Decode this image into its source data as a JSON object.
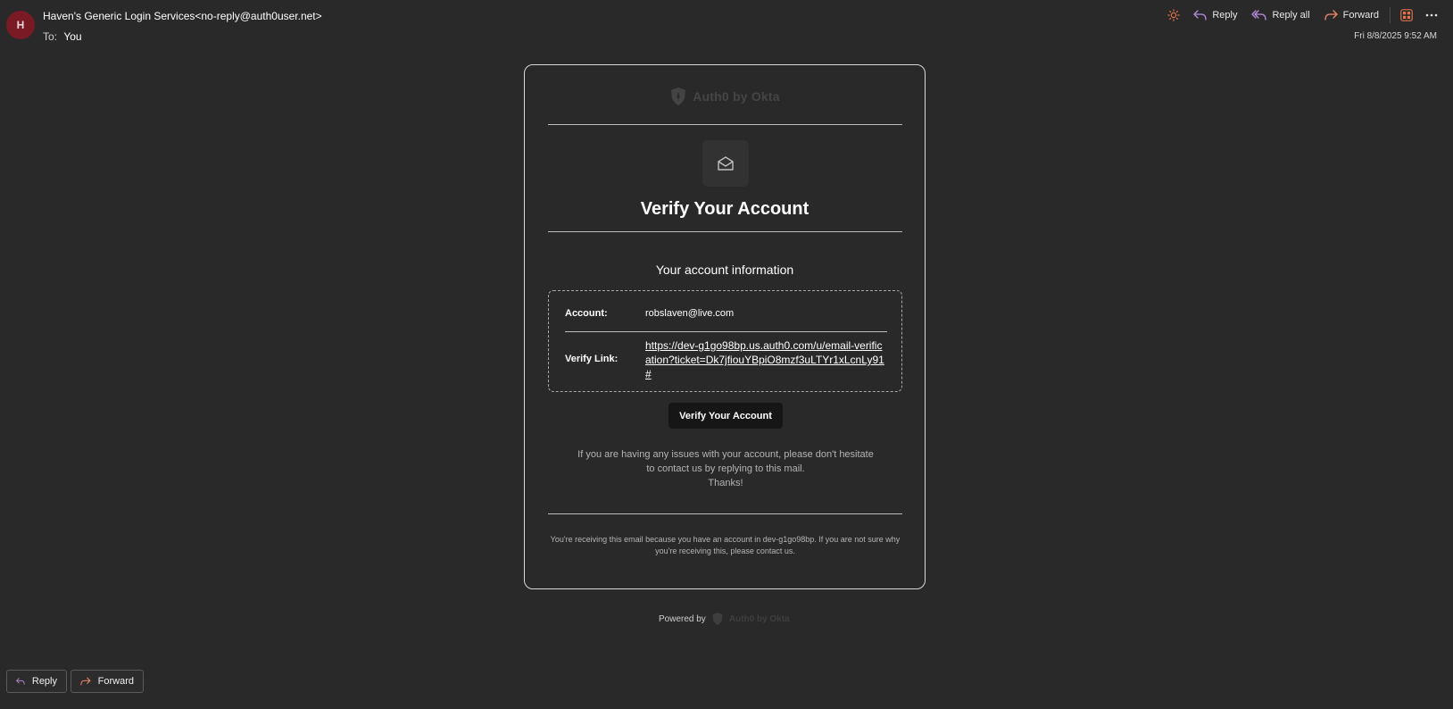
{
  "header": {
    "avatar_initial": "H",
    "sender": "Haven's Generic Login Services<no-reply@auth0user.net>",
    "to_label": "To:",
    "to_value": "You",
    "date": "Fri 8/8/2025 9:52 AM",
    "toolbar": {
      "reply": "Reply",
      "reply_all": "Reply all",
      "forward": "Forward"
    }
  },
  "email": {
    "logo_text": "Auth0 by Okta",
    "title": "Verify Your Account",
    "info_heading": "Your account information",
    "account_label": "Account:",
    "account_value": "robslaven@live.com",
    "verify_label": "Verify Link:",
    "verify_link": "https://dev-g1go98bp.us.auth0.com/u/email-verification?ticket=Dk7jfiouYBpiO8mzf3uLTYr1xLcnLy91#",
    "button_label": "Verify Your Account",
    "help_line1": "If you are having any issues with your account, please don't hesitate",
    "help_line2": "to contact us by replying to this mail.",
    "help_line3": "Thanks!",
    "footer": "You're receiving this email because you have an account in dev-g1go98bp. If you are not sure why you're receiving this, please contact us.",
    "powered_by": "Powered by",
    "powered_logo_text": "Auth0 by Okta"
  },
  "bottom": {
    "reply": "Reply",
    "forward": "Forward"
  },
  "colors": {
    "background": "#292929",
    "avatar": "#7a1a24",
    "reply_icon": "#b88be0",
    "forward_icon": "#f08a6a",
    "accent_orange": "#e0734a"
  },
  "icons": [
    "sun-icon",
    "reply-icon",
    "reply-all-icon",
    "forward-icon",
    "apps-icon",
    "more-icon",
    "shield-logo-icon",
    "envelope-open-icon"
  ]
}
